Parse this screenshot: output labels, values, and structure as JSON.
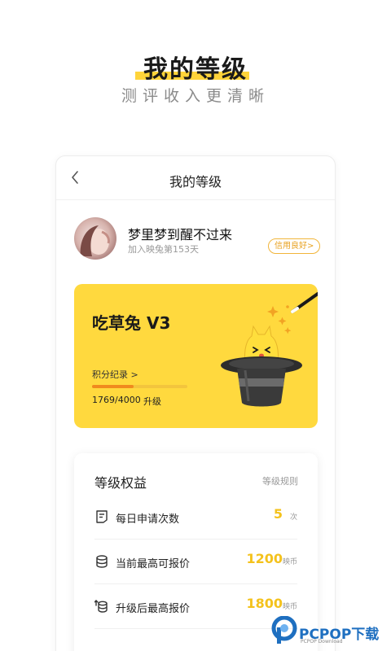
{
  "hero": {
    "title": "我的等级",
    "subtitle": "测评收入更清晰"
  },
  "nav": {
    "title": "我的等级",
    "back_icon": "chevron-left-icon"
  },
  "profile": {
    "username": "梦里梦到醒不过来",
    "join_info": "加入映兔第153天",
    "credit_badge": "信用良好>"
  },
  "level_card": {
    "level_name": "吃草兔 V3",
    "points_link": "积分纪录 >",
    "points_value": "1769/4000",
    "progress_fraction": 0.44,
    "upgrade_label": "升级",
    "bg_color": "#ffd93e"
  },
  "benefits": {
    "title": "等级权益",
    "rules_link": "等级规则",
    "items": [
      {
        "icon": "application-form-icon",
        "label": "每日申请次数",
        "value": "5",
        "unit": "次"
      },
      {
        "icon": "coin-stack-icon",
        "label": "当前最高可报价",
        "value": "1200",
        "unit": "映币"
      },
      {
        "icon": "upgrade-coins-icon",
        "label": "升级后最高报价",
        "value": "1800",
        "unit": "映币"
      }
    ]
  },
  "watermark": {
    "text": "PCPOP下载",
    "sub": "PCPOP Download"
  },
  "colors": {
    "accent_yellow": "#ffd43a",
    "value_yellow": "#f4c21c",
    "progress_orange": "#f08a1e",
    "brand_blue": "#1e6fc0"
  }
}
